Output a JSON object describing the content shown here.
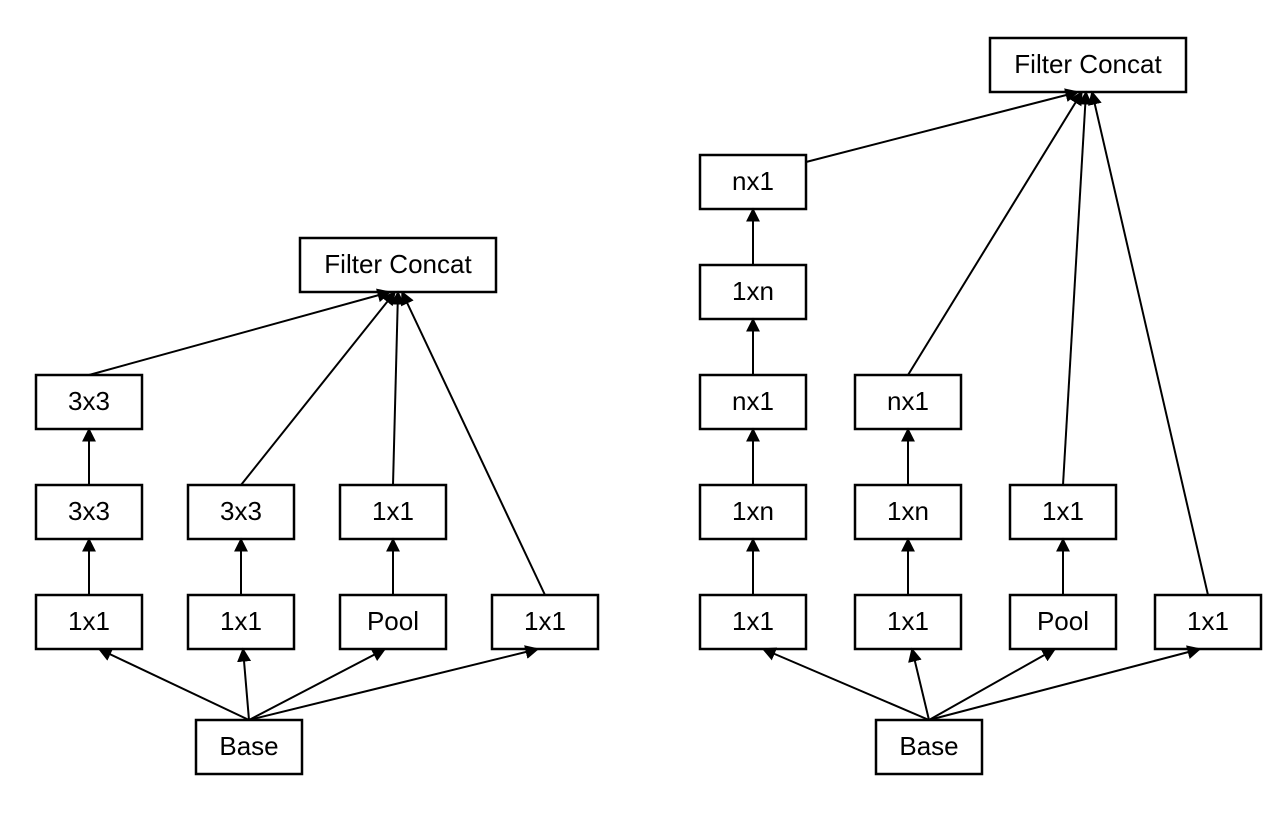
{
  "diagram": {
    "left": {
      "concat": "Filter Concat",
      "base": "Base",
      "c1": {
        "n0": "1x1",
        "n1": "3x3",
        "n2": "3x3"
      },
      "c2": {
        "n0": "1x1",
        "n1": "3x3"
      },
      "c3": {
        "n0": "Pool",
        "n1": "1x1"
      },
      "c4": {
        "n0": "1x1"
      }
    },
    "right": {
      "concat": "Filter Concat",
      "base": "Base",
      "c1": {
        "n0": "1x1",
        "n1": "1xn",
        "n2": "nx1",
        "n3": "1xn",
        "n4": "nx1"
      },
      "c2": {
        "n0": "1x1",
        "n1": "1xn",
        "n2": "nx1"
      },
      "c3": {
        "n0": "Pool",
        "n1": "1x1"
      },
      "c4": {
        "n0": "1x1"
      }
    }
  }
}
